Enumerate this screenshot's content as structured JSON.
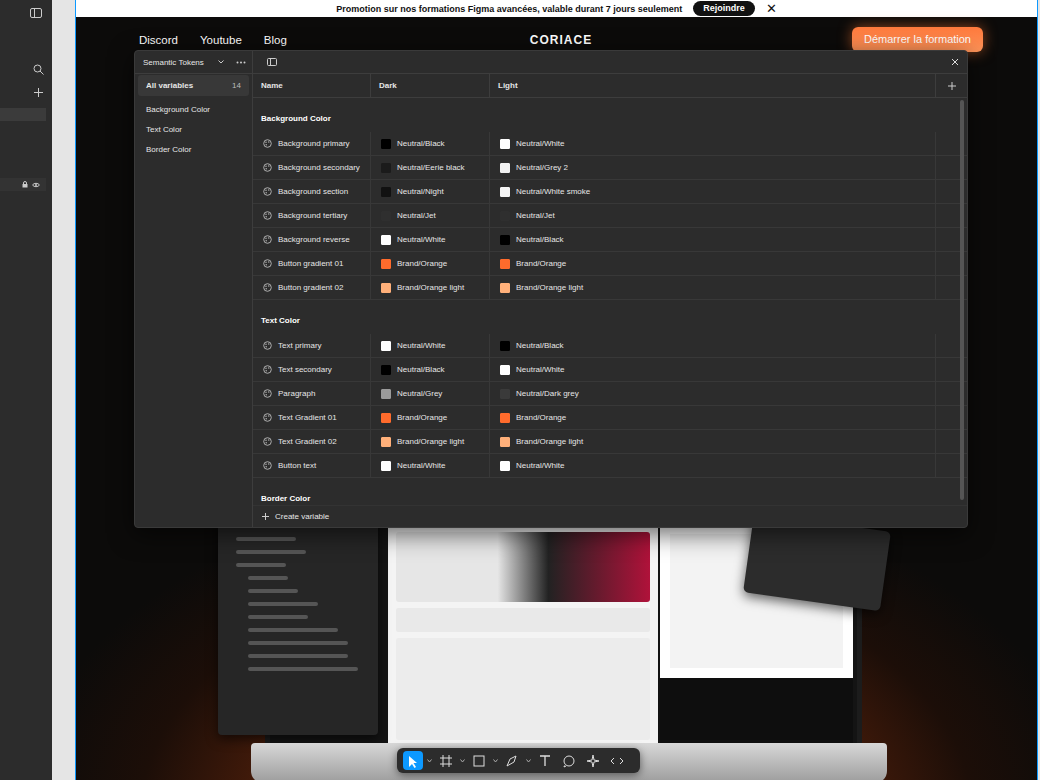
{
  "layers_panel": {
    "rows": [
      {
        "selected": true,
        "locked": false,
        "hovered": false
      },
      {
        "selected": false,
        "locked": true,
        "hovered": true
      }
    ]
  },
  "banner": {
    "text": "Promotion sur nos formations Figma avancées, valable durant 7 jours seulement",
    "button": "Rejoindre",
    "close": "✕"
  },
  "nav": {
    "links": [
      "Discord",
      "Youtube",
      "Blog"
    ],
    "logo": "CORIACE",
    "cta": "Démarrer la formation"
  },
  "variables": {
    "collection": "Semantic Tokens",
    "sidebar": [
      {
        "label": "All variables",
        "count": "14",
        "selected": true
      },
      {
        "label": "Background Color",
        "count": "",
        "selected": false
      },
      {
        "label": "Text Color",
        "count": "",
        "selected": false
      },
      {
        "label": "Border Color",
        "count": "",
        "selected": false
      }
    ],
    "columns": [
      "Name",
      "Dark",
      "Light"
    ],
    "groups": [
      {
        "title": "Background Color",
        "rows": [
          {
            "name": "Background primary",
            "dark": {
              "label": "Neutral/Black",
              "color": "#000000"
            },
            "light": {
              "label": "Neutral/White",
              "color": "#ffffff"
            }
          },
          {
            "name": "Background secondary",
            "dark": {
              "label": "Neutral/Eerie black",
              "color": "#1b1b1b"
            },
            "light": {
              "label": "Neutral/Grey 2",
              "color": "#f0f0f0"
            }
          },
          {
            "name": "Background section",
            "dark": {
              "label": "Neutral/Night",
              "color": "#111111"
            },
            "light": {
              "label": "Neutral/White smoke",
              "color": "#f5f5f5"
            }
          },
          {
            "name": "Background tertiary",
            "dark": {
              "label": "Neutral/Jet",
              "color": "#2f2f2f"
            },
            "light": {
              "label": "Neutral/Jet",
              "color": "#2f2f2f"
            }
          },
          {
            "name": "Background reverse",
            "dark": {
              "label": "Neutral/White",
              "color": "#ffffff"
            },
            "light": {
              "label": "Neutral/Black",
              "color": "#000000"
            }
          },
          {
            "name": "Button gradient 01",
            "dark": {
              "label": "Brand/Orange",
              "color": "#ff6b2c"
            },
            "light": {
              "label": "Brand/Orange",
              "color": "#ff6b2c"
            }
          },
          {
            "name": "Button gradient 02",
            "dark": {
              "label": "Brand/Orange light",
              "color": "#ffb07a"
            },
            "light": {
              "label": "Brand/Orange light",
              "color": "#ffb07a"
            }
          }
        ]
      },
      {
        "title": "Text Color",
        "rows": [
          {
            "name": "Text primary",
            "dark": {
              "label": "Neutral/White",
              "color": "#ffffff"
            },
            "light": {
              "label": "Neutral/Black",
              "color": "#000000"
            }
          },
          {
            "name": "Text secondary",
            "dark": {
              "label": "Neutral/Black",
              "color": "#000000"
            },
            "light": {
              "label": "Neutral/White",
              "color": "#ffffff"
            }
          },
          {
            "name": "Paragraph",
            "dark": {
              "label": "Neutral/Grey",
              "color": "#9b9b9b"
            },
            "light": {
              "label": "Neutral/Dark grey",
              "color": "#3a3a3a"
            }
          },
          {
            "name": "Text Gradient 01",
            "dark": {
              "label": "Brand/Orange",
              "color": "#ff6b2c"
            },
            "light": {
              "label": "Brand/Orange",
              "color": "#ff6b2c"
            }
          },
          {
            "name": "Text Gradient 02",
            "dark": {
              "label": "Brand/Orange light",
              "color": "#ffb07a"
            },
            "light": {
              "label": "Brand/Orange light",
              "color": "#ffb07a"
            }
          },
          {
            "name": "Button text",
            "dark": {
              "label": "Neutral/White",
              "color": "#ffffff"
            },
            "light": {
              "label": "Neutral/White",
              "color": "#ffffff"
            }
          }
        ]
      },
      {
        "title": "Border Color",
        "rows": []
      }
    ],
    "create": "Create variable"
  },
  "toolbar": {
    "tools": [
      {
        "selected": true
      },
      {
        "selected": false
      },
      {
        "selected": false
      },
      {
        "selected": false
      },
      {
        "selected": false
      },
      {
        "selected": false
      },
      {
        "selected": false
      },
      {
        "selected": false
      }
    ]
  }
}
